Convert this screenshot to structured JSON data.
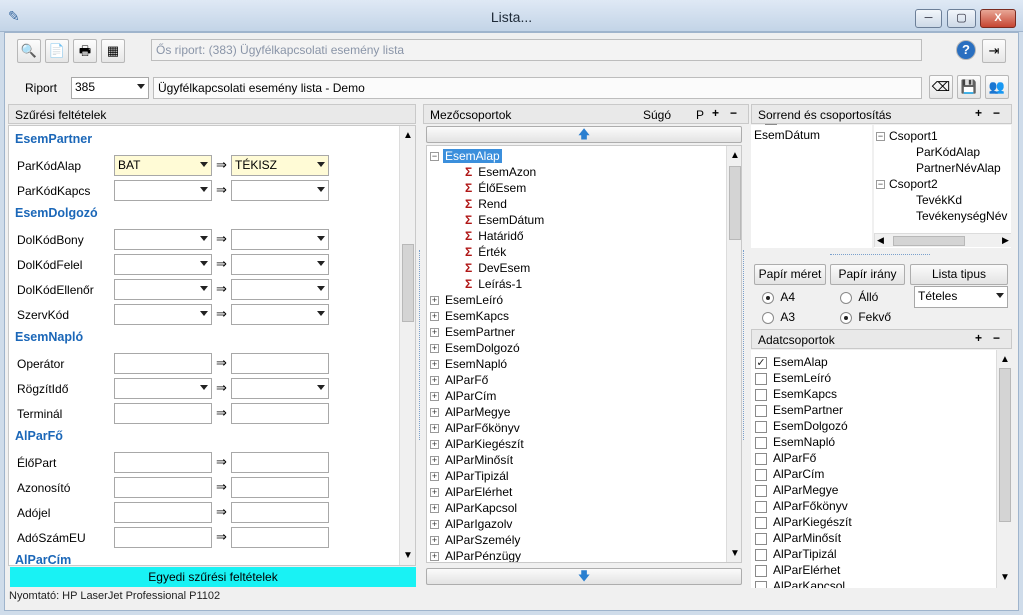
{
  "window": {
    "title": "Lista...",
    "min": "─",
    "max": "▢",
    "close": "X"
  },
  "toolbar": {
    "report_desc": "Ős riport: (383)  Ügyfélkapcsolati esemény lista"
  },
  "report": {
    "label": "Riport",
    "id": "385",
    "name": "Ügyfélkapcsolati esemény lista - Demo"
  },
  "filters": {
    "header": "Szűrési feltételek",
    "footer_btn": "Egyedi szűrési feltételek",
    "sections": [
      {
        "title": "EsemPartner",
        "rows": [
          {
            "label": "ParKódAlap",
            "from": "BAT",
            "to": "TÉKISZ",
            "dd": true,
            "yellow": true
          },
          {
            "label": "ParKódKapcs",
            "from": "",
            "to": "",
            "dd": true
          }
        ]
      },
      {
        "title": "EsemDolgozó",
        "rows": [
          {
            "label": "DolKódBony",
            "from": "",
            "to": "",
            "dd": true
          },
          {
            "label": "DolKódFelel",
            "from": "",
            "to": "",
            "dd": true
          },
          {
            "label": "DolKódEllenőr",
            "from": "",
            "to": "",
            "dd": true
          },
          {
            "label": "SzervKód",
            "from": "",
            "to": "",
            "dd": true
          }
        ]
      },
      {
        "title": "EsemNapló",
        "rows": [
          {
            "label": "Operátor",
            "from": "",
            "to": "",
            "dd": false
          },
          {
            "label": "RögzítIdő",
            "from": "",
            "to": "",
            "dd": true
          },
          {
            "label": "Terminál",
            "from": "",
            "to": "",
            "dd": false
          }
        ]
      },
      {
        "title": "AlParFő",
        "rows": [
          {
            "label": "ÉlőPart",
            "from": "",
            "to": "",
            "dd": false
          },
          {
            "label": "Azonosító",
            "from": "",
            "to": "",
            "dd": false
          },
          {
            "label": "Adójel",
            "from": "",
            "to": "",
            "dd": false
          },
          {
            "label": "AdóSzámEU",
            "from": "",
            "to": "",
            "dd": false
          }
        ]
      },
      {
        "title": "AlParCím",
        "rows": []
      }
    ]
  },
  "fields": {
    "header": "Mezőcsoportok",
    "help": "Súgó",
    "p": "P",
    "expanded": "EsemAlap",
    "children": [
      "EsemAzon",
      "ÉlőEsem",
      "Rend",
      "EsemDátum",
      "Határidő",
      "Érték",
      "DevEsem",
      "Leírás-1"
    ],
    "groups": [
      "EsemLeíró",
      "EsemKapcs",
      "EsemPartner",
      "EsemDolgozó",
      "EsemNapló",
      "AlParFő",
      "AlParCím",
      "AlParMegye",
      "AlParFőkönyv",
      "AlParKiegészít",
      "AlParMinősít",
      "AlParTipizál",
      "AlParElérhet",
      "AlParKapcsol",
      "AlParIgazolv",
      "AlParSzemély",
      "AlParPénzügy"
    ]
  },
  "sort": {
    "header": "Sorrend és csoportosítás",
    "order_field": "EsemDátum",
    "groups": [
      {
        "name": "Csoport1",
        "items": [
          "ParKódAlap",
          "PartnerNévAlap"
        ]
      },
      {
        "name": "Csoport2",
        "items": [
          "TevékKd",
          "TevékenységNév"
        ]
      }
    ],
    "paper_size_btn": "Papír méret",
    "paper_dir_btn": "Papír irány",
    "list_type_btn": "Lista tipus",
    "a4": "A4",
    "a3": "A3",
    "allo": "Álló",
    "fekvo": "Fekvő",
    "list_type": "Tételes"
  },
  "data_groups": {
    "header": "Adatcsoportok",
    "items": [
      {
        "name": "EsemAlap",
        "checked": true
      },
      {
        "name": "EsemLeíró",
        "checked": false
      },
      {
        "name": "EsemKapcs",
        "checked": false
      },
      {
        "name": "EsemPartner",
        "checked": false
      },
      {
        "name": "EsemDolgozó",
        "checked": false
      },
      {
        "name": "EsemNapló",
        "checked": false
      },
      {
        "name": "AlParFő",
        "checked": false
      },
      {
        "name": "AlParCím",
        "checked": false
      },
      {
        "name": "AlParMegye",
        "checked": false
      },
      {
        "name": "AlParFőkönyv",
        "checked": false
      },
      {
        "name": "AlParKiegészít",
        "checked": false
      },
      {
        "name": "AlParMinősít",
        "checked": false
      },
      {
        "name": "AlParTipizál",
        "checked": false
      },
      {
        "name": "AlParElérhet",
        "checked": false
      },
      {
        "name": "AlParKapcsol",
        "checked": false
      }
    ]
  },
  "status": {
    "printer": "Nyomtató: HP LaserJet Professional P1102"
  }
}
